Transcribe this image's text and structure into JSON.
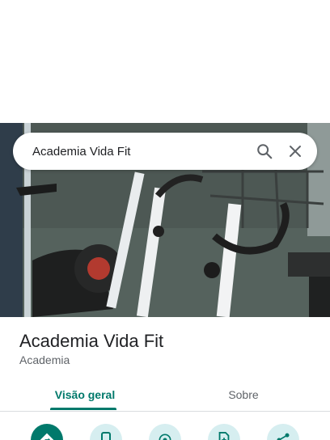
{
  "search": {
    "query": "Academia Vida Fit"
  },
  "place": {
    "name": "Academia Vida Fit",
    "category": "Academia"
  },
  "tabs": [
    {
      "label": "Visão geral",
      "active": true
    },
    {
      "label": "Sobre",
      "active": false
    }
  ],
  "actions": [
    "directions-icon",
    "phone-icon",
    "location-icon",
    "save-icon",
    "share-icon"
  ],
  "colors": {
    "accent": "#00796b",
    "action_bg": "#d6eef0"
  }
}
